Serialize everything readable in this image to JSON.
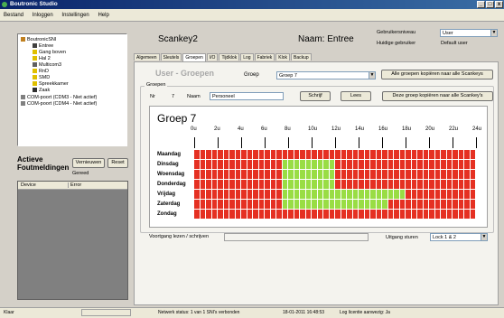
{
  "app": {
    "title": "Boutronic Studio",
    "min": "_",
    "max": "□",
    "close": "x"
  },
  "menu": [
    "Bestand",
    "Inloggen",
    "Instellingen",
    "Help"
  ],
  "tree": [
    {
      "label": "BoutronicSNI",
      "icon": "home-icon",
      "color": "#c08020"
    },
    {
      "label": "Entree",
      "icon": "door-icon",
      "color": "#404040"
    },
    {
      "label": "Gang boven",
      "icon": "key-icon",
      "color": "#e0c000"
    },
    {
      "label": "Hal 2",
      "icon": "key-icon",
      "color": "#e0c000"
    },
    {
      "label": "Multicom3",
      "icon": "device-icon",
      "color": "#606060"
    },
    {
      "label": "RnD",
      "icon": "key-icon",
      "color": "#e0c000"
    },
    {
      "label": "SMD",
      "icon": "key-icon",
      "color": "#e0c000"
    },
    {
      "label": "Spreekkamer",
      "icon": "key-icon",
      "color": "#e0c000"
    },
    {
      "label": "Zaak",
      "icon": "lock-icon",
      "color": "#303030"
    },
    {
      "label": "COM-poort (CDM3 - Niet actief)",
      "icon": "port-icon",
      "color": "#808080"
    },
    {
      "label": "COM-poort (CDM4 - Niet actief)",
      "icon": "port-icon",
      "color": "#808080"
    }
  ],
  "alerts": {
    "title_line1": "Actieve",
    "title_line2": "Foutmeldingen",
    "refresh": "Vernieuwen",
    "reset": "Reset",
    "status": "Gereed",
    "col_device": "Device",
    "col_error": "Error"
  },
  "header": {
    "scankey": "Scankey2",
    "name": "Naam: Entree",
    "level_label": "Gebruikersniveau",
    "level_value": "User",
    "current_label": "Huidige gebruiker",
    "current_value": "Default user"
  },
  "tabs": [
    "Algemeen",
    "Sleutels",
    "Groepen",
    "I/O",
    "Tijdklok",
    "Log",
    "Fabriek",
    "Klok",
    "Backup"
  ],
  "active_tab": 2,
  "section": {
    "title": "User - Groepen",
    "group_label": "Groep",
    "group_value": "Groep 7",
    "copy_all": "Alle groepen kopiëren naar alle Scankeys"
  },
  "groups": {
    "legend": "Groepen",
    "nr_label": "Nr",
    "nr_value": "7",
    "name_label": "Naam",
    "name_value": "Personeel",
    "write": "Schrijf",
    "read": "Lees",
    "copy_group": "Deze groep kopiëren naar alle Scankey's"
  },
  "schedule": {
    "title": "Groep 7",
    "hours": [
      "0u",
      "2u",
      "4u",
      "6u",
      "8u",
      "10u",
      "12u",
      "14u",
      "16u",
      "18u",
      "20u",
      "22u",
      "24u"
    ],
    "days": [
      "Maandag",
      "Dinsdag",
      "Woensdag",
      "Donderdag",
      "Vrijdag",
      "Zaterdag",
      "Zondag"
    ],
    "green_ranges": [
      [],
      [
        [
          7.5,
          12
        ]
      ],
      [
        [
          7.5,
          12
        ]
      ],
      [
        [
          7.5,
          12
        ]
      ],
      [
        [
          7.5,
          18
        ]
      ],
      [
        [
          7.5,
          12
        ],
        [
          12,
          16.5
        ]
      ],
      []
    ],
    "red": "#e53022",
    "green": "#99dd44"
  },
  "bottom": {
    "progress_label": "Voortgang lezen / schrijven",
    "output_label": "Uitgang sturen",
    "output_value": "Lock 1 & 2"
  },
  "status": {
    "left": "Klaar",
    "network": "Netwerk status: 1 van 1 SNI's verbonden",
    "datetime": "18-01-2011 16:48:53",
    "license": "Log licentie aanwezig: Ja"
  }
}
